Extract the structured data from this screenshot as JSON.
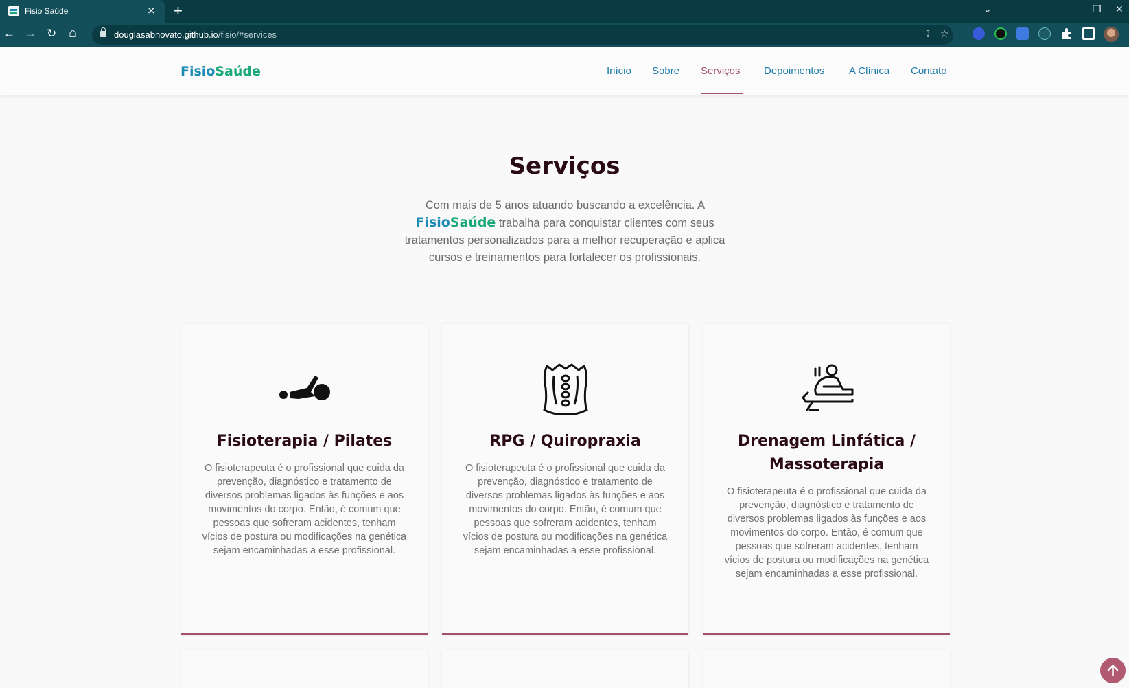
{
  "browser": {
    "tab_title": "Fisio Saúde",
    "tab_close": "×",
    "new_tab": "+",
    "url_domain": "douglasabnovato.github.io",
    "url_path": "/fisio/#services",
    "controls": {
      "dropdown": "⌄",
      "minimize": "—",
      "restore": "❐",
      "close": "✕"
    },
    "nav": {
      "back": "←",
      "forward": "→",
      "reload": "↻",
      "home": "⌂"
    },
    "omni_icons": {
      "share": "⇪",
      "bookmark": "☆"
    }
  },
  "header": {
    "logo_a": "Fisio",
    "logo_b": "Saúde",
    "nav": [
      "Início",
      "Sobre",
      "Serviços",
      "Depoimentos",
      "A Clínica",
      "Contato"
    ],
    "active_nav": "Serviços"
  },
  "services": {
    "title": "Serviços",
    "intro_before": "Com mais de 5 anos atuando buscando a excelência. A",
    "brand_a": "Fisio",
    "brand_b": "Saúde",
    "intro_after": "trabalha para conquistar clientes com seus tratamentos personalizados para a melhor recuperação e aplica cursos e treinamentos para fortalecer os profissionais.",
    "cards": [
      {
        "icon": "pilates-icon",
        "title": "Fisioterapia / Pilates",
        "text": "O fisioterapeuta é o profissional que cuida da prevenção, diagnóstico e tratamento de diversos problemas ligados às funções e aos movimentos do corpo. Então, é comum que pessoas que sofreram acidentes, tenham vícios de postura ou modificações na genética sejam encaminhadas a esse profissional."
      },
      {
        "icon": "spine-icon",
        "title": "RPG / Quiropraxia",
        "text": "O fisioterapeuta é o profissional que cuida da prevenção, diagnóstico e tratamento de diversos problemas ligados às funções e aos movimentos do corpo. Então, é comum que pessoas que sofreram acidentes, tenham vícios de postura ou modificações na genética sejam encaminhadas a esse profissional."
      },
      {
        "icon": "massage-icon",
        "title": "Drenagem Linfática / Massoterapia",
        "text": "O fisioterapeuta é o profissional que cuida da prevenção, diagnóstico e tratamento de diversos problemas ligados às funções e aos movimentos do corpo. Então, é comum que pessoas que sofreram acidentes, tenham vícios de postura ou modificações na genética sejam encaminhadas a esse profissional."
      }
    ]
  },
  "colors": {
    "brand_blue": "#1b8ab5",
    "brand_green": "#1aa978",
    "accent": "#a3506a",
    "heading": "#2a0a14",
    "chrome": "#134f5a"
  }
}
